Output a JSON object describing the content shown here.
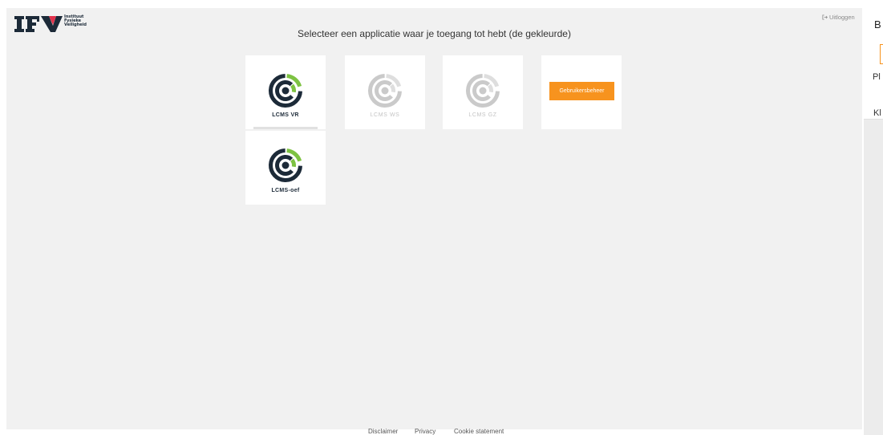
{
  "logo": {
    "mark": "IFV",
    "tagline": [
      "Instituut",
      "Fysieke",
      "Veiligheid"
    ]
  },
  "header": {
    "logout_label": "Uitloggen",
    "logout_icon": "logout-icon"
  },
  "main": {
    "title": "Selecteer een applicatie waar je toegang tot hebt (de gekleurde)"
  },
  "apps": [
    {
      "label": "LCMS VR",
      "enabled": true,
      "icon": "lcms-logo-icon"
    },
    {
      "label": "LCMS WS",
      "enabled": false,
      "icon": "lcms-logo-icon"
    },
    {
      "label": "LCMS GZ",
      "enabled": false,
      "icon": "lcms-logo-icon"
    },
    {
      "button_label": "Gebruikersbeheer",
      "enabled": true
    },
    {
      "label": "LCMS-oef",
      "enabled": true,
      "icon": "lcms-logo-icon"
    }
  ],
  "side_panel": {
    "heading": "B",
    "item_1": "Pl",
    "item_2": "Kl"
  },
  "footer": {
    "links": [
      "Disclaimer",
      "Privacy",
      "Cookie statement"
    ]
  },
  "colors": {
    "page_bg": "#f1f1f1",
    "card_bg": "#ffffff",
    "accent_orange": "#f7931e",
    "logo_navy": "#1c2a38",
    "logo_green": "#7dc242",
    "logo_red": "#e2314b",
    "disabled_gray": "#cacaca"
  }
}
